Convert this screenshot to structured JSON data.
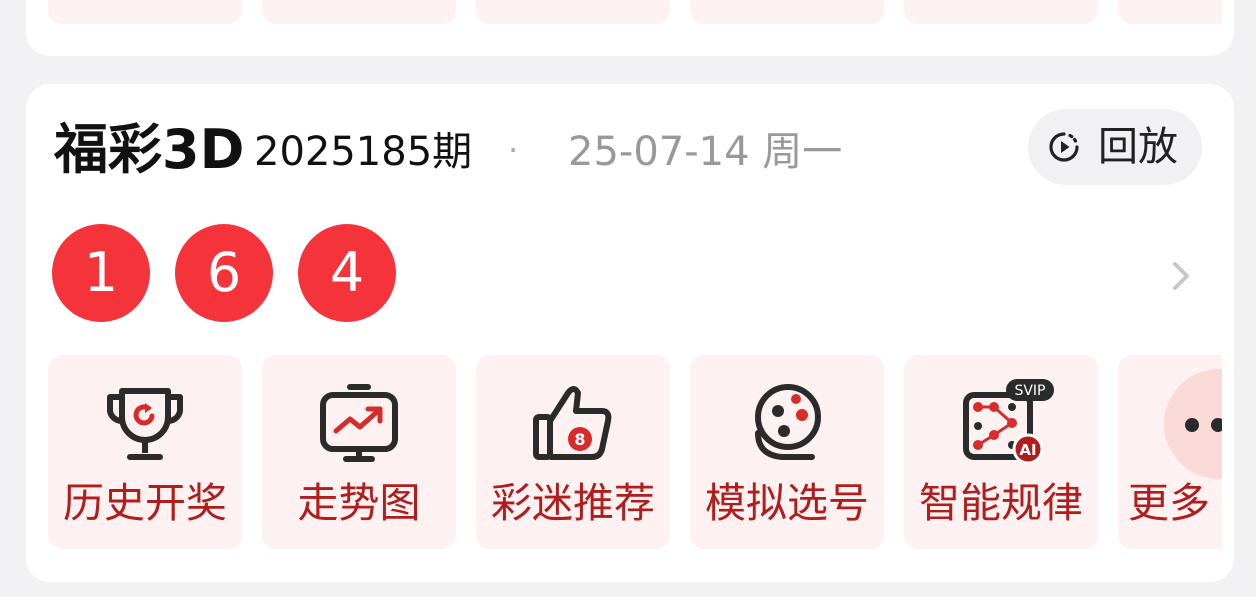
{
  "lottery": {
    "name": "福彩3D",
    "issue": "2025185期",
    "separator": "·",
    "date": "25-07-14 周一",
    "replay_label": "回放",
    "numbers": [
      "1",
      "6",
      "4"
    ]
  },
  "tiles": [
    {
      "label": "历史开奖",
      "icon": "trophy-icon"
    },
    {
      "label": "走势图",
      "icon": "trend-chart-icon"
    },
    {
      "label": "彩迷推荐",
      "icon": "thumbs-up-icon",
      "badge": "8"
    },
    {
      "label": "模拟选号",
      "icon": "lottery-ball-machine-icon"
    },
    {
      "label": "智能规律",
      "icon": "ai-pattern-icon",
      "badge": "SVIP",
      "badge2": "AI"
    },
    {
      "label": "更多",
      "icon": "more-icon"
    }
  ],
  "colors": {
    "ball": "#f5333a",
    "tile_bg": "#fdf2f1",
    "tile_label": "#b11c1c",
    "icon_accent": "#d62c2c"
  }
}
